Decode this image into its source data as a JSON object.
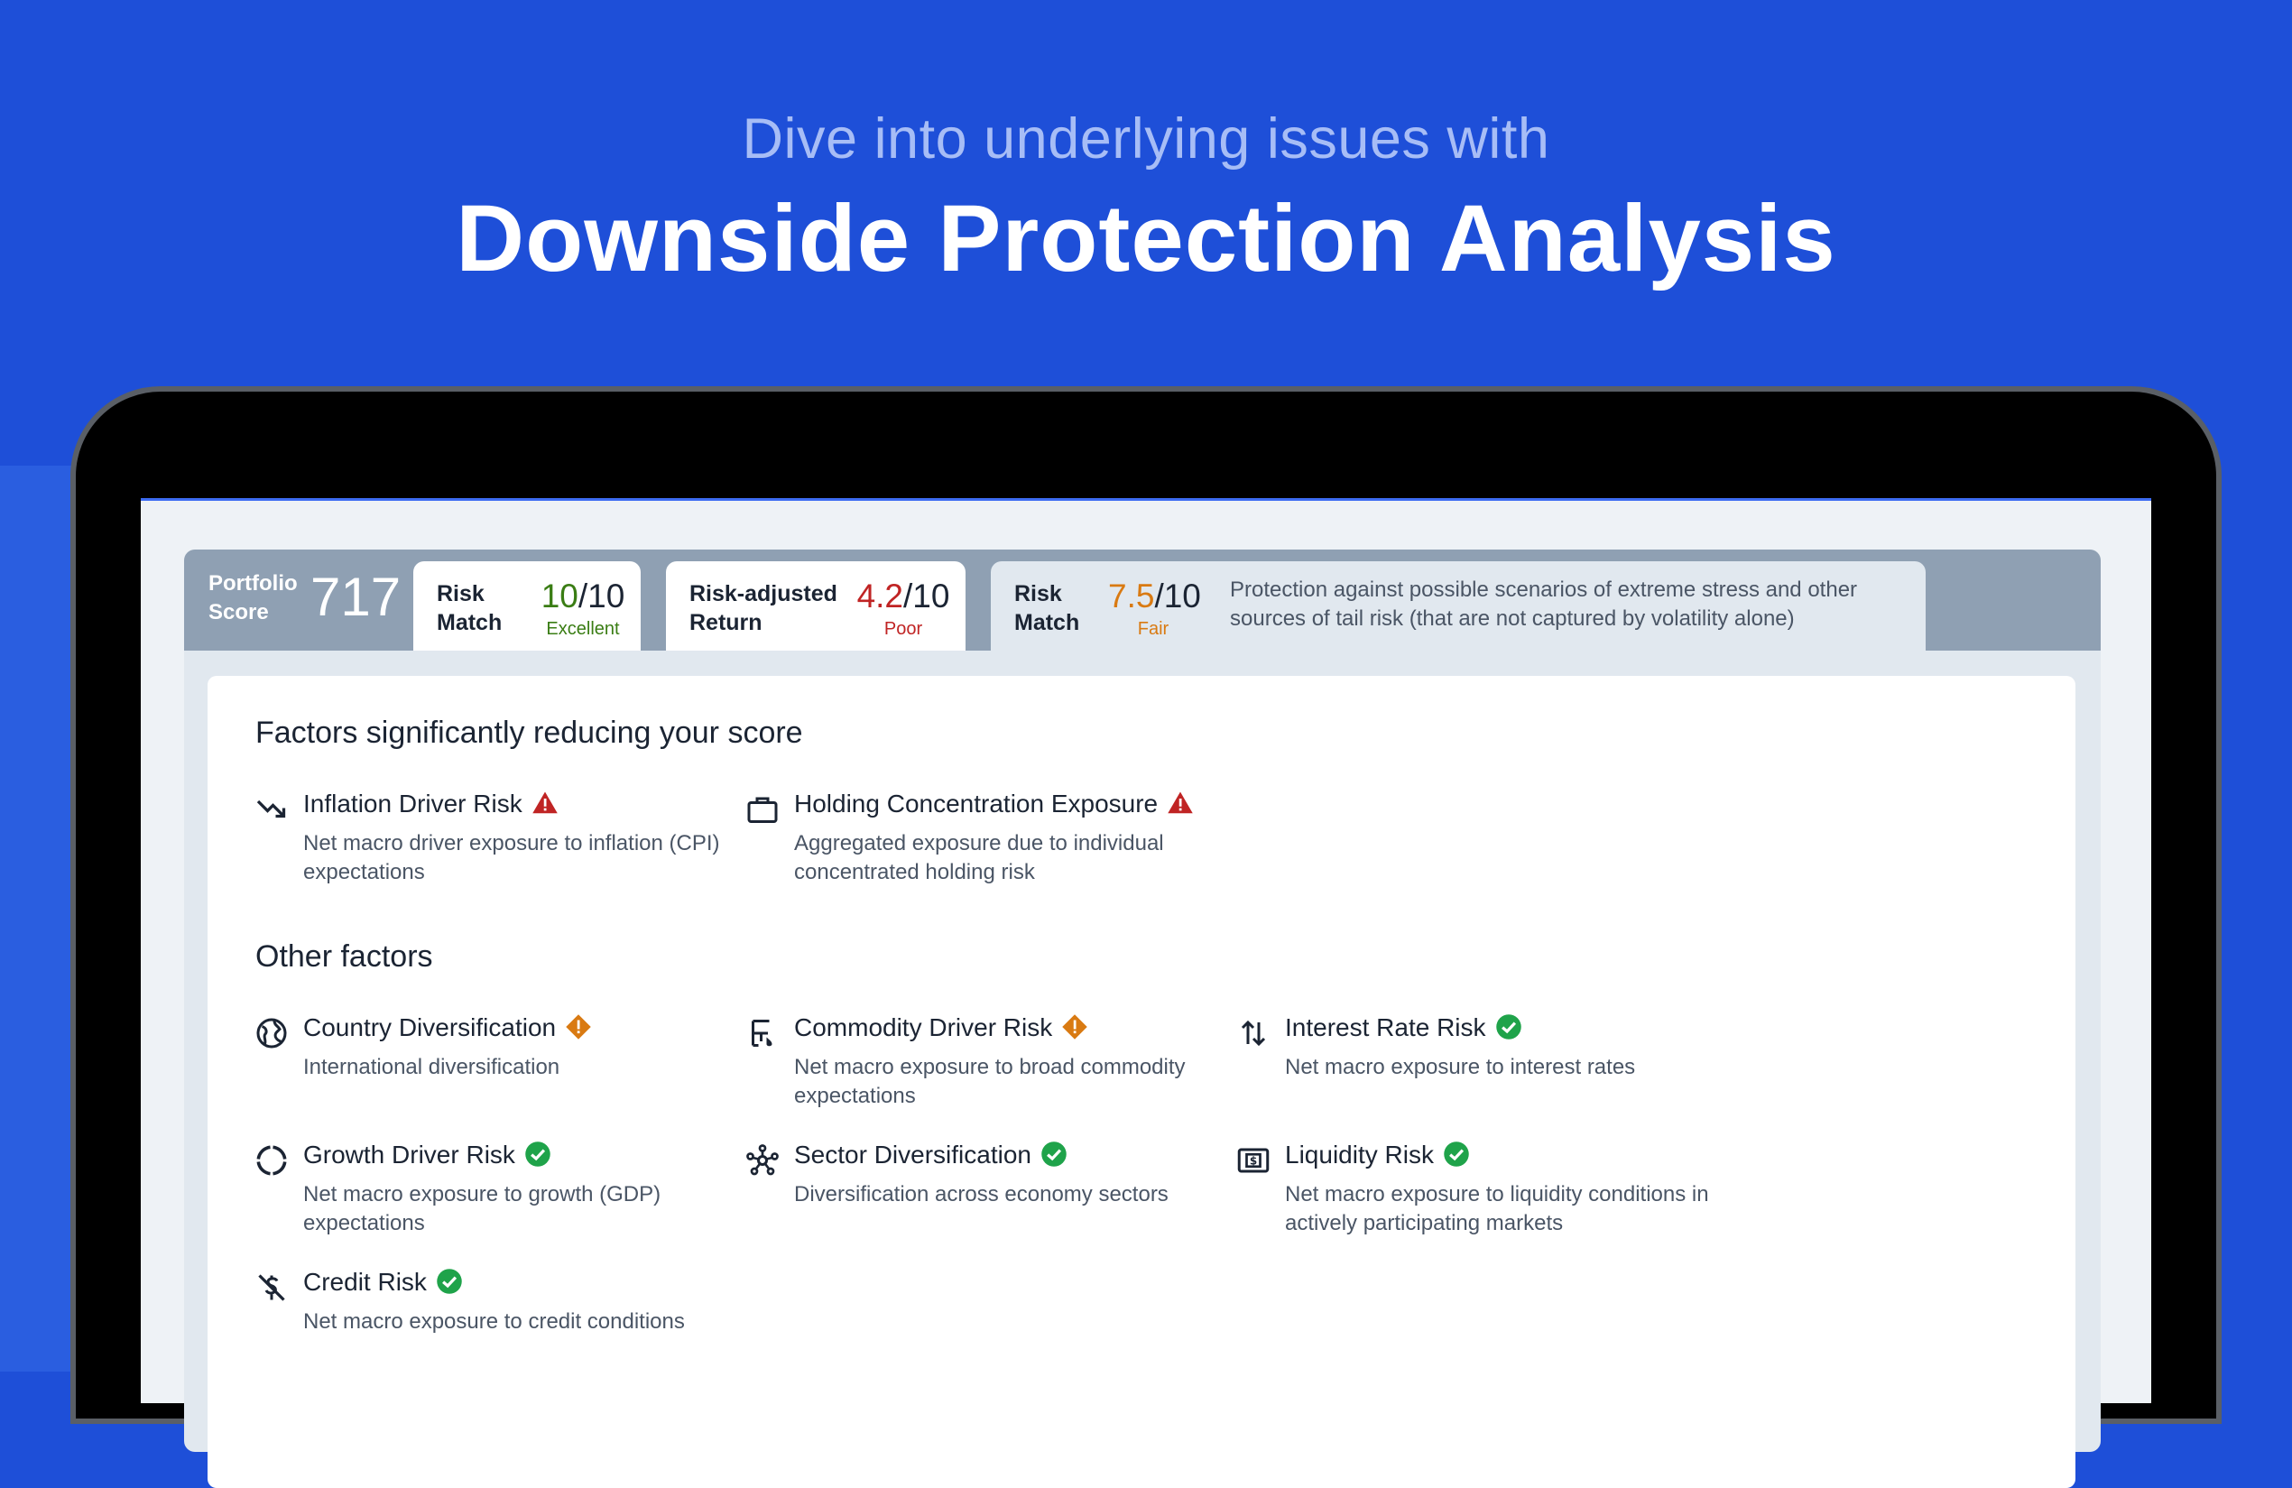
{
  "hero": {
    "subtitle": "Dive into underlying issues with",
    "title": "Downside Protection Analysis"
  },
  "colors": {
    "background": "#1e4fd8",
    "excellent": "#3a7d14",
    "poor": "#c02424",
    "fair": "#d97a12",
    "status_ok": "#1fa34a",
    "status_warning": "#d97a12",
    "status_critical": "#c02424"
  },
  "portfolio": {
    "label": "Portfolio Score",
    "score": "717"
  },
  "tabs": [
    {
      "label_line1": "Risk",
      "label_line2": "Match",
      "score": "10",
      "out_of": "/10",
      "rating": "Excellent"
    },
    {
      "label_line1": "Risk-adjusted",
      "label_line2": "Return",
      "score": "4.2",
      "out_of": "/10",
      "rating": "Poor"
    },
    {
      "label_line1": "Risk",
      "label_line2": "Match",
      "score": "7.5",
      "out_of": "/10",
      "rating": "Fair",
      "description": "Protection against possible scenarios of extreme stress and other sources of tail risk (that are not captured by volatility alone)"
    }
  ],
  "sections": {
    "significant_title": "Factors significantly reducing your score",
    "other_title": "Other factors"
  },
  "factors": [
    {
      "name": "Inflation Driver Risk",
      "desc": "Net macro driver exposure to inflation (CPI) expectations",
      "icon": "trend-down-icon",
      "status": "critical"
    },
    {
      "name": "Holding Concentration Exposure",
      "desc": "Aggregated exposure due to individual concentrated holding risk",
      "icon": "briefcase-icon",
      "status": "critical"
    },
    {
      "name": "Country Diversification",
      "desc": "International diversification",
      "icon": "globe-icon",
      "status": "warning"
    },
    {
      "name": "Commodity Driver Risk",
      "desc": "Net macro exposure to broad commodity expectations",
      "icon": "commodity-icon",
      "status": "warning"
    },
    {
      "name": "Interest Rate Risk",
      "desc": "Net macro exposure to interest rates",
      "icon": "up-down-arrows-icon",
      "status": "ok"
    },
    {
      "name": "Growth Driver Risk",
      "desc": "Net macro exposure to growth (GDP) expectations",
      "icon": "cycle-icon",
      "status": "ok"
    },
    {
      "name": "Sector Diversification",
      "desc": "Diversification across economy sectors",
      "icon": "network-icon",
      "status": "ok"
    },
    {
      "name": "Liquidity Risk",
      "desc": "Net macro exposure to liquidity conditions in actively participating markets",
      "icon": "dollar-bill-icon",
      "status": "ok"
    },
    {
      "name": "Credit Risk",
      "desc": "Net macro exposure to credit conditions",
      "icon": "no-dollar-icon",
      "status": "ok"
    }
  ]
}
